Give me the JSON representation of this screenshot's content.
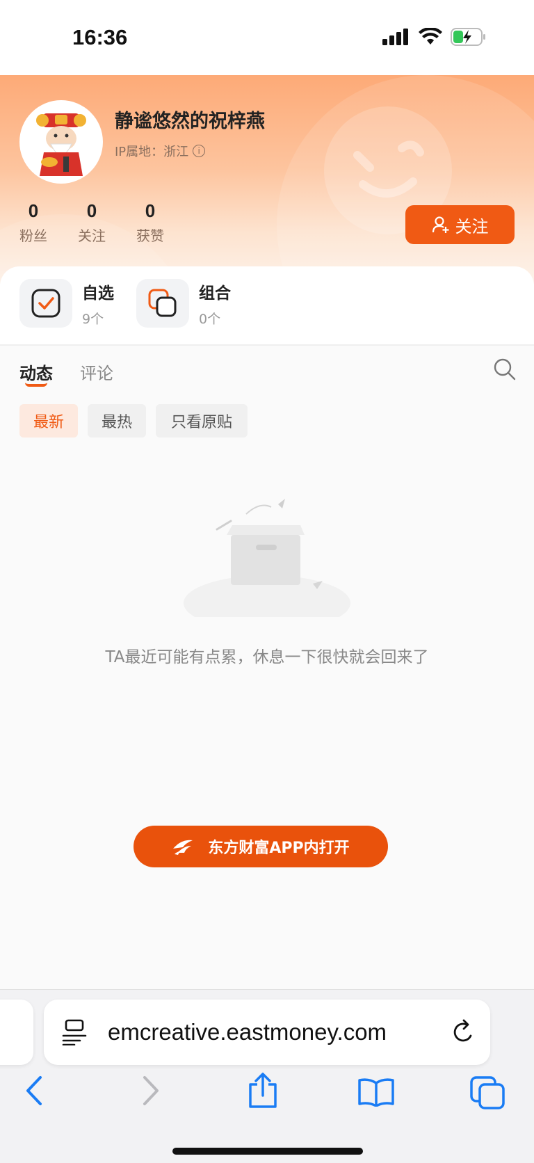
{
  "status_bar": {
    "time": "16:36"
  },
  "profile": {
    "username": "静谧悠然的祝梓燕",
    "ip_location": "IP属地：浙江",
    "stats": [
      {
        "value": "0",
        "label": "粉丝"
      },
      {
        "value": "0",
        "label": "关注"
      },
      {
        "value": "0",
        "label": "获赞"
      }
    ],
    "follow_label": "关注"
  },
  "cards": [
    {
      "title": "自选",
      "count": "9个"
    },
    {
      "title": "组合",
      "count": "0个"
    }
  ],
  "tabs": [
    {
      "label": "动态",
      "active": true
    },
    {
      "label": "评论",
      "active": false
    }
  ],
  "filters": [
    "最新",
    "最热",
    "只看原贴"
  ],
  "empty_message": "TA最近可能有点累，休息一下很快就会回来了",
  "open_app_label": "东方财富APP内打开",
  "browser": {
    "url": "emcreative.eastmoney.com"
  },
  "colors": {
    "accent": "#f05a14",
    "header_top": "#fdaa77",
    "accent_light": "#fde9df"
  }
}
